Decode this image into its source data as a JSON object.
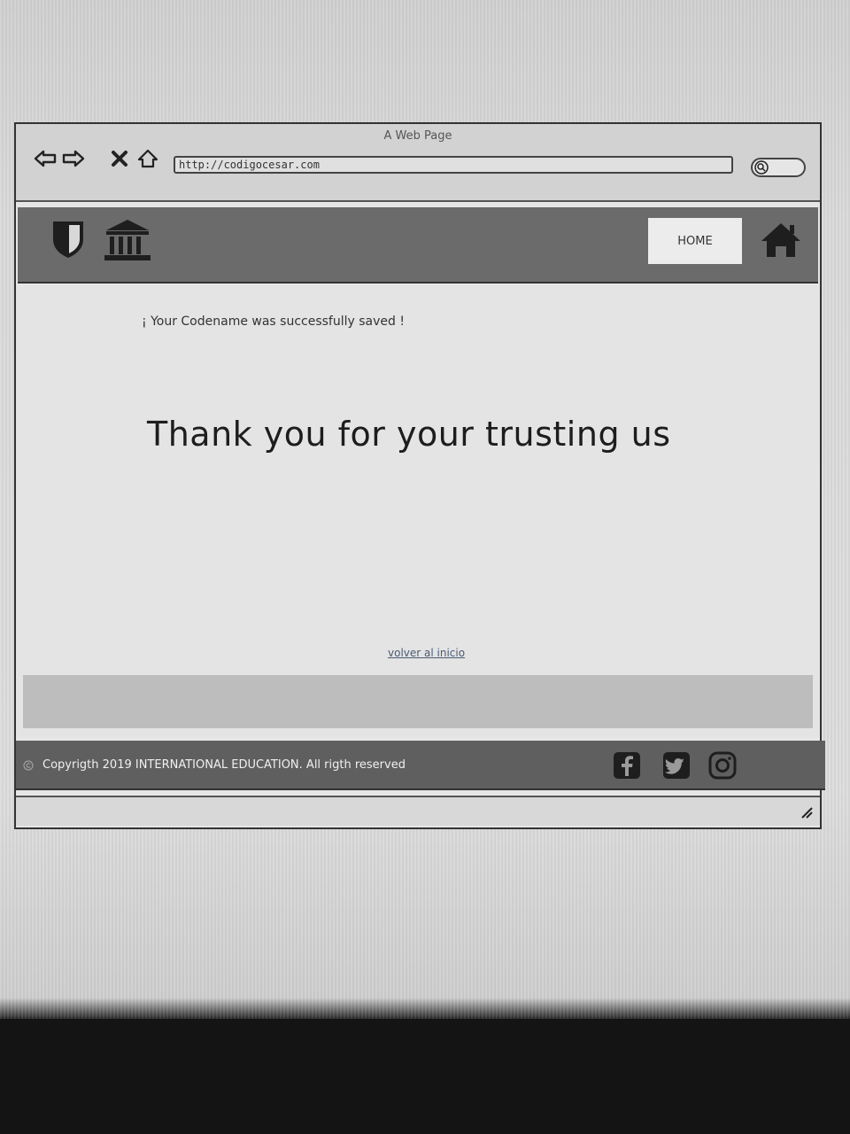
{
  "window": {
    "title": "A Web Page",
    "url": "http://codigocesar.com"
  },
  "header": {
    "home_label": "HOME"
  },
  "content": {
    "saved_message": "¡ Your Codename was successfully saved !",
    "thanks_heading": "Thank you for your trusting us",
    "back_link": "volver al inicio"
  },
  "footer": {
    "copyright": "Copyrigth 2019 INTERNATIONAL EDUCATION. All rigth reserved"
  },
  "icons": {
    "back": "arrow-left-icon",
    "forward": "arrow-right-icon",
    "stop": "close-icon",
    "home_nav": "home-outline-icon",
    "search": "search-icon",
    "brand_shield": "shield-icon",
    "brand_bank": "bank-icon",
    "home": "home-icon",
    "facebook": "facebook-icon",
    "twitter": "twitter-icon",
    "instagram": "instagram-icon"
  },
  "colors": {
    "header_bg": "#6b6b6b",
    "footer_bg": "#5f5f5f",
    "link": "#4a5b75"
  }
}
